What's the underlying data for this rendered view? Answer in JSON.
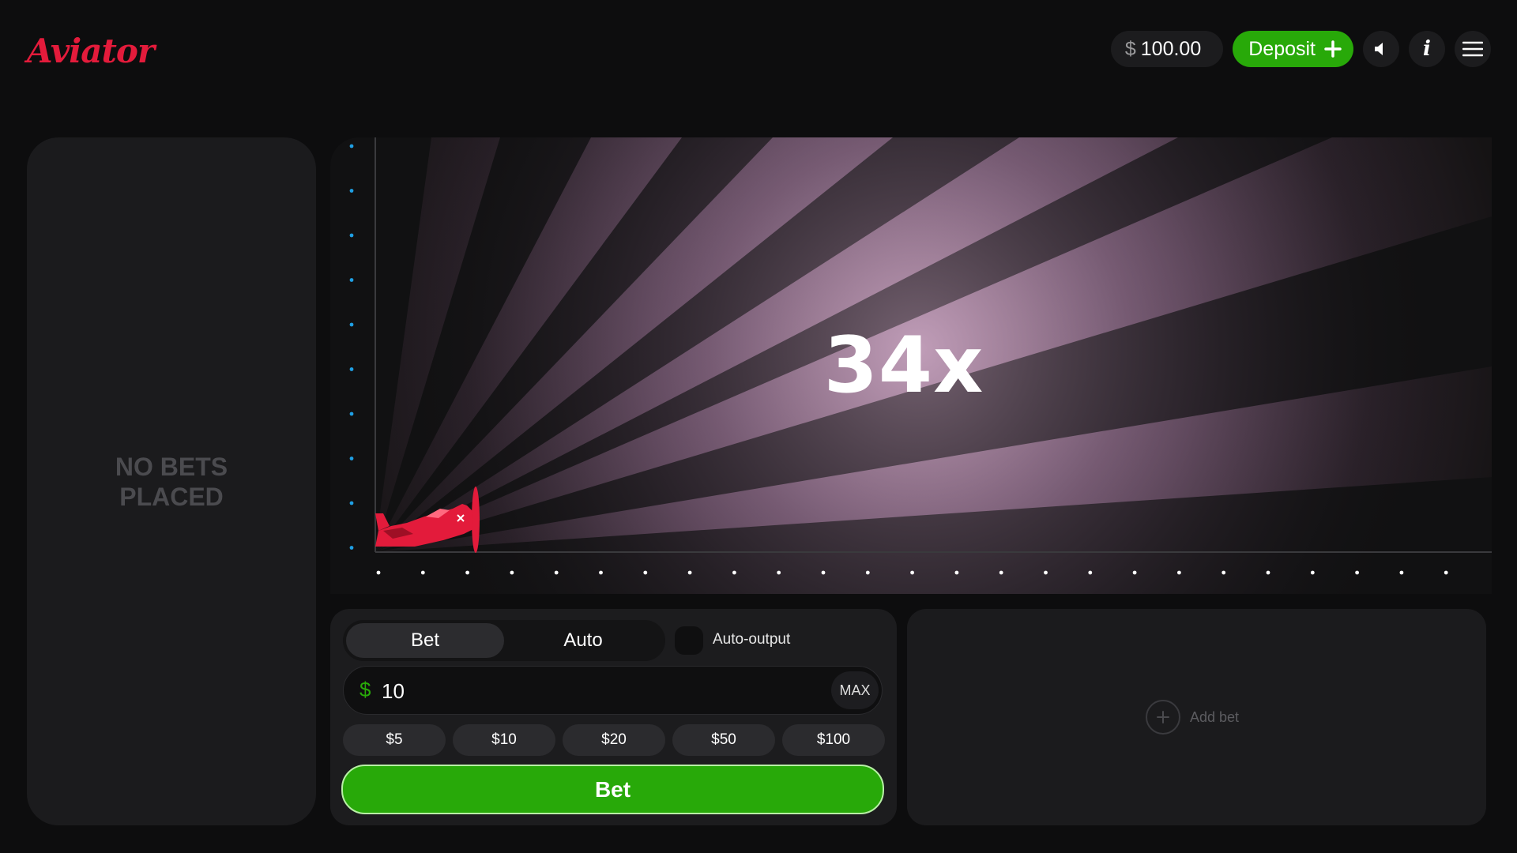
{
  "header": {
    "logo_text": "Aviator",
    "balance": {
      "currency": "$",
      "amount": "100.00"
    },
    "deposit_label": "Deposit",
    "icons": [
      "plus-icon",
      "sound-icon",
      "info-icon",
      "menu-icon"
    ]
  },
  "bets_panel": {
    "empty_line1": "NO BETS",
    "empty_line2": "PLACED"
  },
  "game": {
    "multiplier": "34x",
    "plane_icon": "plane-icon",
    "colors": {
      "plane": "#e31b3b",
      "glow": "#b592ad",
      "axis_dot_left": "#1f9fe3",
      "axis_dot_bottom": "#ffffff"
    }
  },
  "bet_controls": {
    "tabs": [
      "Bet",
      "Auto"
    ],
    "active_tab": "Bet",
    "auto_output_label": "Auto-output",
    "currency": "$",
    "amount": "10",
    "max_label": "MAX",
    "quick_amounts": [
      "$5",
      "$10",
      "$20",
      "$50",
      "$100"
    ],
    "bet_button_label": "Bet"
  },
  "add_bet": {
    "label": "Add bet"
  },
  "colors": {
    "accent_green": "#28a909",
    "brand_red": "#e31b3b",
    "panel": "#1c1c1e",
    "background": "#0d0d0e"
  }
}
